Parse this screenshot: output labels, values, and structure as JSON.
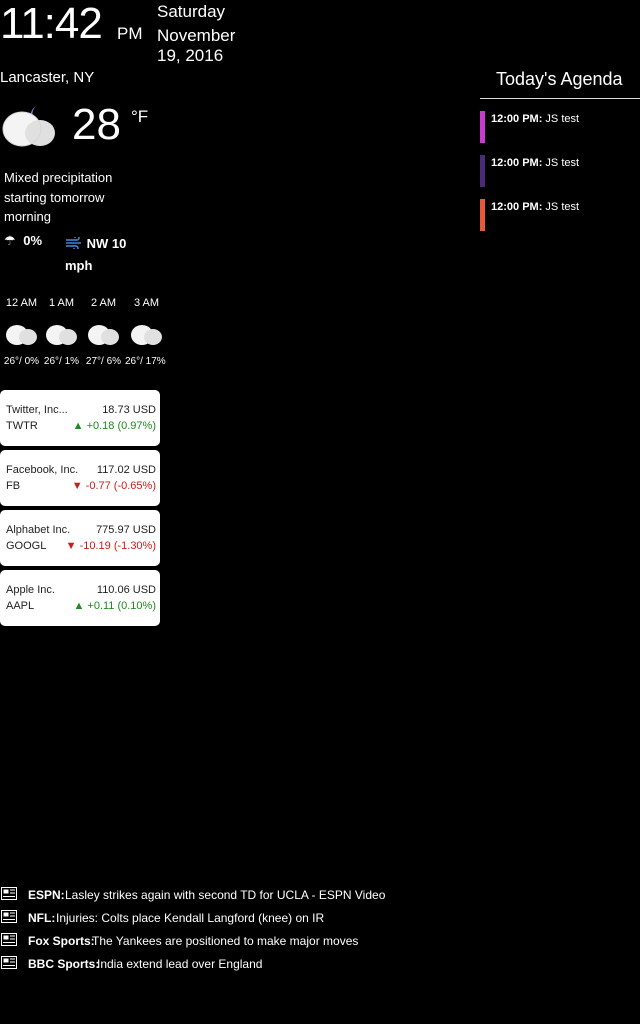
{
  "clock": {
    "time": "11:42",
    "ampm": "PM",
    "day": "Saturday",
    "date": "November 19, 2016"
  },
  "weather": {
    "location": "Lancaster, NY",
    "temp": "28",
    "unit": "°F",
    "icon": "partly-cloudy-night-icon",
    "summary": "Mixed precipitation starting tomorrow morning",
    "precip": "0%",
    "wind": "NW 10 mph",
    "hourly": [
      {
        "time": "12 AM",
        "temp_precip": "26°/ 0%"
      },
      {
        "time": "1 AM",
        "temp_precip": "26°/ 1%"
      },
      {
        "time": "2 AM",
        "temp_precip": "27°/ 6%"
      },
      {
        "time": "3 AM",
        "temp_precip": "26°/ 17%"
      }
    ]
  },
  "stocks": [
    {
      "name": "Twitter, Inc...",
      "price": "18.73 USD",
      "symbol": "TWTR",
      "change": "▲ +0.18 (0.97%)",
      "direction": "up"
    },
    {
      "name": "Facebook, Inc.",
      "price": "117.02 USD",
      "symbol": "FB",
      "change": "▼ -0.77 (-0.65%)",
      "direction": "down"
    },
    {
      "name": "Alphabet Inc.",
      "price": "775.97 USD",
      "symbol": "GOOGL",
      "change": "▼ -10.19 (-1.30%)",
      "direction": "down"
    },
    {
      "name": "Apple Inc.",
      "price": "110.06 USD",
      "symbol": "AAPL",
      "change": "▲ +0.11 (0.10%)",
      "direction": "up"
    }
  ],
  "agenda": {
    "title": "Today's Agenda",
    "events": [
      {
        "time": "12:00 PM:",
        "title": "JS test",
        "color": "#c93ad0"
      },
      {
        "time": "12:00 PM:",
        "title": "JS test",
        "color": "#4b2a7a"
      },
      {
        "time": "12:00 PM:",
        "title": "JS test",
        "color": "#e8583b"
      }
    ]
  },
  "news": [
    {
      "source": "ESPN:",
      "headline": "Lasley strikes again with second TD for UCLA - ESPN Video"
    },
    {
      "source": "NFL:",
      "headline": "Injuries: Colts place Kendall Langford (knee) on IR"
    },
    {
      "source": "Fox Sports:",
      "headline": "The Yankees are positioned to make major moves"
    },
    {
      "source": "BBC Sports:",
      "headline": "India extend lead over England"
    }
  ],
  "colors": {
    "up": "#1f8a1f",
    "down": "#d11b1b",
    "moon": "#8b76d8"
  }
}
